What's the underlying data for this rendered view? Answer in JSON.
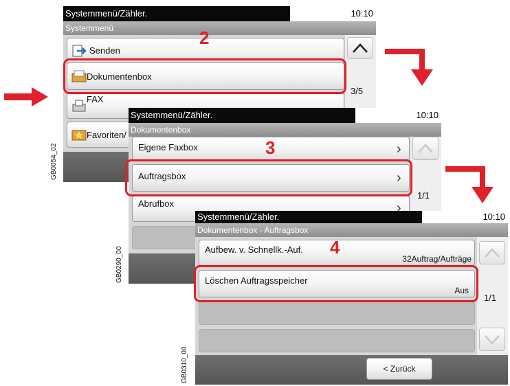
{
  "screen1": {
    "title": "Systemmenü/Zähler.",
    "time": "10:10",
    "subtitle": "Systemmenü",
    "items": [
      "Senden",
      "Dokumentenbox",
      "FAX",
      "Favoriten/"
    ],
    "page": "3/5",
    "figure_code": "GB0054_02"
  },
  "screen2": {
    "title": "Systemmenü/Zähler.",
    "time": "10:10",
    "subtitle": "Dokumentenbox",
    "items": [
      "Eigene Faxbox",
      "Auftragsbox",
      "Abrufbox"
    ],
    "page": "1/1",
    "figure_code": "GB0290_00"
  },
  "screen3": {
    "title": "Systemmenü/Zähler.",
    "time": "10:10",
    "subtitle": "Dokumentenbox - Auftragsbox",
    "items": [
      {
        "label": "Aufbew. v. Schnellk.-Auf.",
        "value": "32Auftrag/Aufträge"
      },
      {
        "label": "Löschen Auftragsspeicher",
        "value": "Aus"
      }
    ],
    "page": "1/1",
    "back": "< Zurück",
    "figure_code": "GB0310_00"
  },
  "steps": [
    "2",
    "3",
    "4"
  ],
  "colors": {
    "highlight": "#e0202a",
    "titlebar": "#0a0a0a"
  }
}
